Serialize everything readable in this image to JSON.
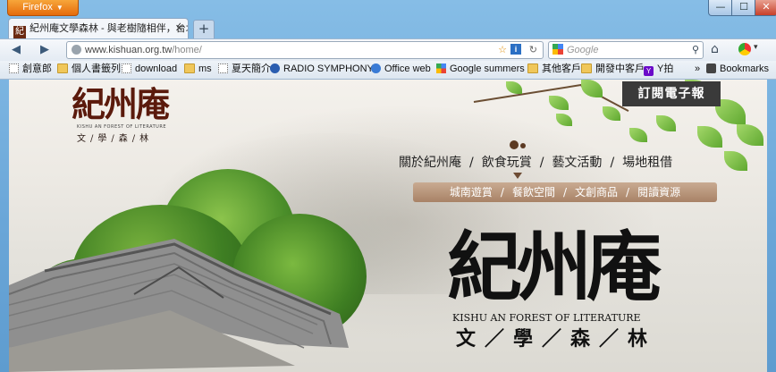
{
  "browser": {
    "app_button": "Firefox",
    "tab_title": "紀州庵文學森林 - 與老樹隨相伴，台北...",
    "tab_close": "✕",
    "new_tab": "+",
    "url_domain": "www.kishuan.org.tw",
    "url_path": "/home/",
    "search_placeholder": "Google",
    "controls": {
      "min": "—",
      "max": "☐",
      "close": "✕"
    }
  },
  "bookmarks": [
    {
      "label": "創意郎",
      "icon": "page-icon"
    },
    {
      "label": "個人書籤列",
      "icon": "folder-icon"
    },
    {
      "label": "download",
      "icon": "page-icon"
    },
    {
      "label": "ms",
      "icon": "folder-icon"
    },
    {
      "label": "夏天簡介",
      "icon": "page-icon"
    },
    {
      "label": "RADIO SYMPHONY",
      "icon": "radio-icon"
    },
    {
      "label": "Office web",
      "icon": "office-icon"
    },
    {
      "label": "Google summers",
      "icon": "google-icon"
    },
    {
      "label": "其他客戶",
      "icon": "folder-icon"
    },
    {
      "label": "開發中客戶",
      "icon": "folder-icon"
    },
    {
      "label": "Y拍",
      "icon": "yahoo-icon"
    }
  ],
  "bookmarks_more": "»",
  "bookmarks_menu": "Bookmarks",
  "site": {
    "subscribe": "訂閱電子報",
    "logo_big": "紀州庵",
    "logo_en": "KISHU AN FOREST OF LITERATURE",
    "logo_sub": "文/學/森/林",
    "nav": [
      "關於紀州庵",
      "飲食玩賞",
      "藝文活動",
      "場地租借"
    ],
    "nav_sep": "/",
    "subnav": [
      "城南遊賞",
      "餐飲空間",
      "文創商品",
      "閱讀資源"
    ],
    "title_big": "紀州庵",
    "title_en": "KISHU AN FOREST OF LITERATURE",
    "title_sub": "文／學／森／林"
  }
}
